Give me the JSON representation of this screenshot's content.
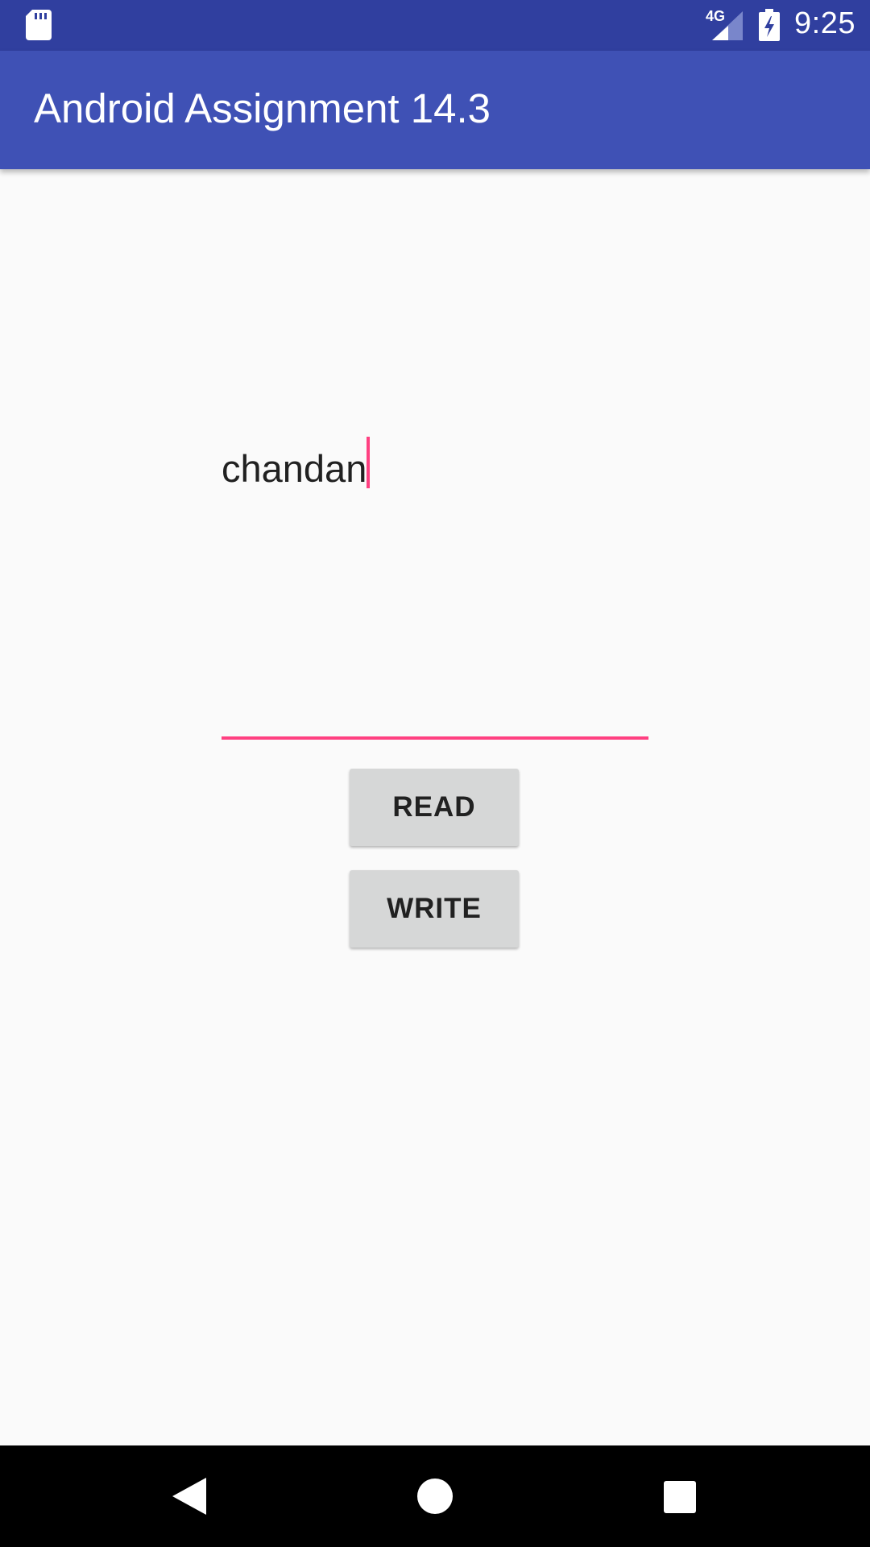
{
  "status_bar": {
    "network_label": "4G",
    "time": "9:25",
    "icons": [
      "sd-card-icon",
      "signal-icon",
      "battery-charging-icon"
    ]
  },
  "app_bar": {
    "title": "Android Assignment 14.3"
  },
  "form": {
    "input_value": "chandan",
    "read_label": "READ",
    "write_label": "WRITE"
  },
  "nav_bar": {
    "icons": [
      "back-icon",
      "home-icon",
      "recents-icon"
    ]
  },
  "colors": {
    "status_bar": "#303f9f",
    "app_bar": "#3f51b5",
    "accent": "#ff4081",
    "background": "#fafafa",
    "button": "#d6d7d7"
  }
}
